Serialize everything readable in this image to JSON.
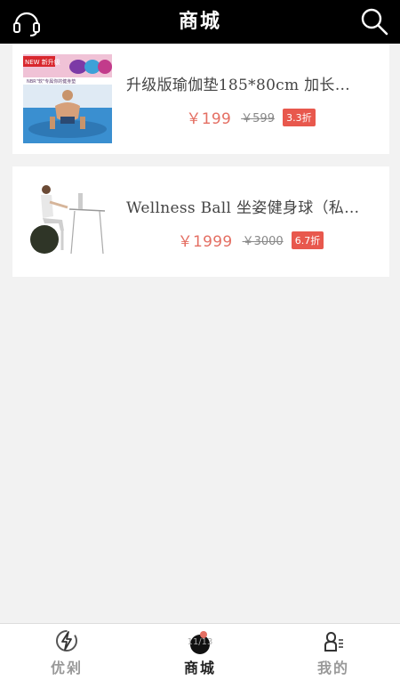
{
  "header": {
    "title": "商城",
    "left_icon": "headset-icon",
    "right_icon": "search-icon"
  },
  "products": [
    {
      "name": "升级版瑜伽垫185*80cm 加长…",
      "price": "￥199",
      "original_price": "￥599",
      "discount": "3.3折",
      "thumb_banner": "NEW 新升级",
      "thumb_caption": "NBR\"软\"专属你的健身垫"
    },
    {
      "name": "Wellness Ball 坐姿健身球（私…",
      "price": "￥1999",
      "original_price": "￥3000",
      "discount": "6.7折"
    }
  ],
  "tabbar": {
    "tabs": [
      {
        "label": "优剁",
        "icon": "lightning-icon"
      },
      {
        "label": "商城",
        "icon": "shop-icon",
        "extra_text": "11/13"
      },
      {
        "label": "我的",
        "icon": "user-icon"
      }
    ],
    "active_index": 1
  },
  "colors": {
    "price": "#e46f63",
    "discount_bg": "#e8584d",
    "header_bg": "#000000"
  }
}
